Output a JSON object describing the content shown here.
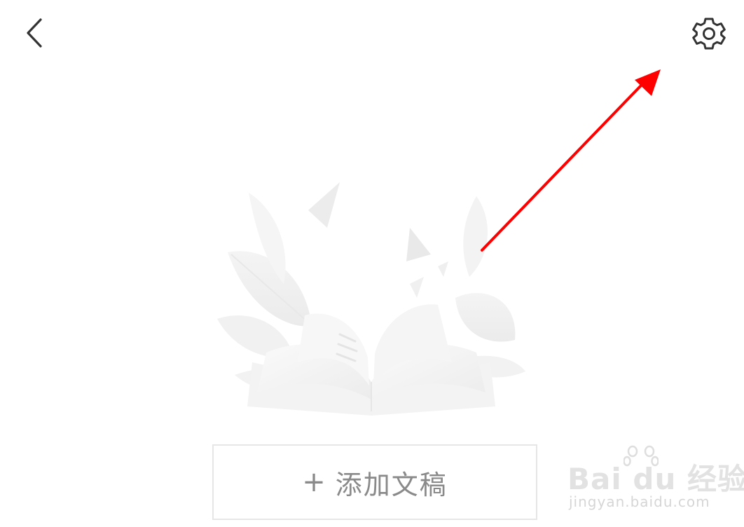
{
  "header": {
    "back_icon": "chevron-left-icon",
    "settings_icon": "gear-icon"
  },
  "main": {
    "add_draft": {
      "plus": "+",
      "label": "添加文稿"
    }
  },
  "watermark": {
    "brand": "Bai du 经验",
    "url": "jingyan.baidu.com"
  },
  "colors": {
    "arrow": "#ff0000",
    "icon": "#333333",
    "button_text": "#8a8a8a",
    "button_border": "#e6e6e6",
    "illustration": "#f2f2f2"
  }
}
